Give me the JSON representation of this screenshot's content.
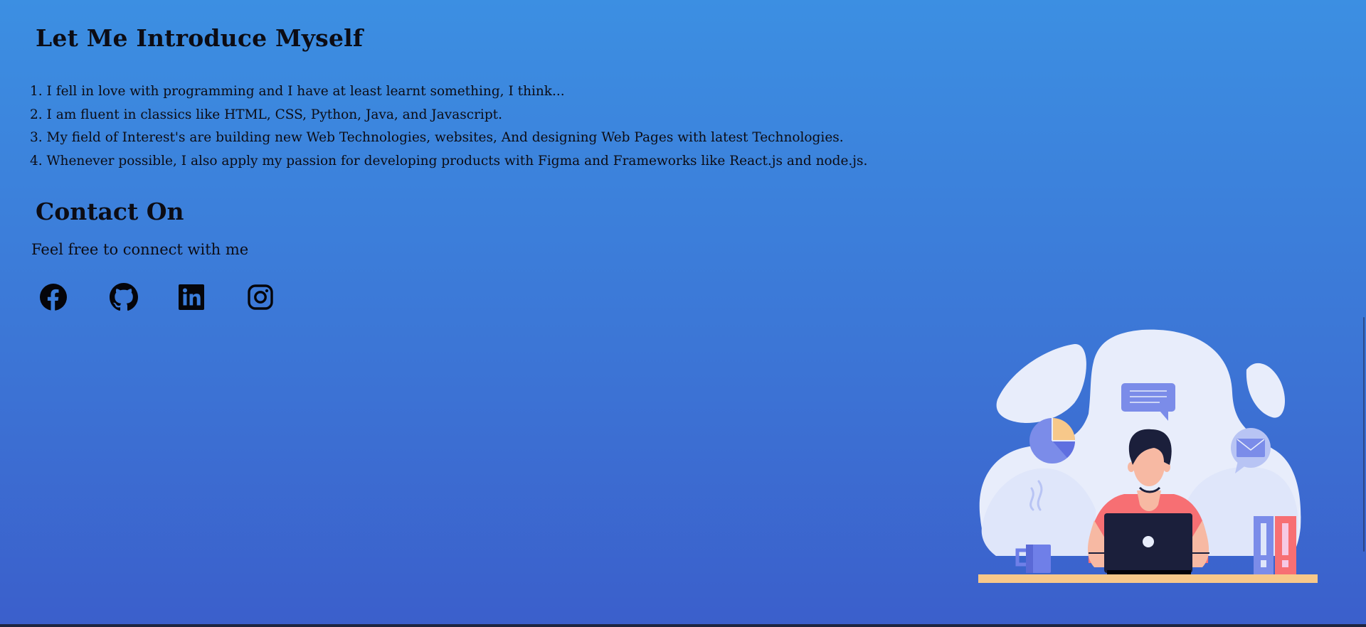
{
  "intro": {
    "title": "Let Me Introduce Myself",
    "items": [
      "1. I fell in love with programming and I have at least learnt something, I think...",
      "2. I am fluent in classics like HTML, CSS, Python, Java, and Javascript.",
      "3. My field of Interest's are building new Web Technologies, websites, And designing Web Pages with latest Technologies.",
      "4. Whenever possible, I also apply my passion for developing products with Figma and Frameworks like React.js and node.js."
    ]
  },
  "contact": {
    "title": "Contact On",
    "subtitle": "Feel free to connect with me",
    "socials": [
      {
        "icon": "facebook-icon"
      },
      {
        "icon": "github-icon"
      },
      {
        "icon": "linkedin-icon"
      },
      {
        "icon": "instagram-icon"
      }
    ]
  },
  "colors": {
    "background_top": "#3c8fe2",
    "background_bottom": "#3b5fcb",
    "text": "#0c0c14",
    "illustration_blob": "#e8edfb",
    "illustration_accent": "#6f7fe8",
    "illustration_shirt": "#f76f73",
    "illustration_desk": "#f7c88a"
  }
}
